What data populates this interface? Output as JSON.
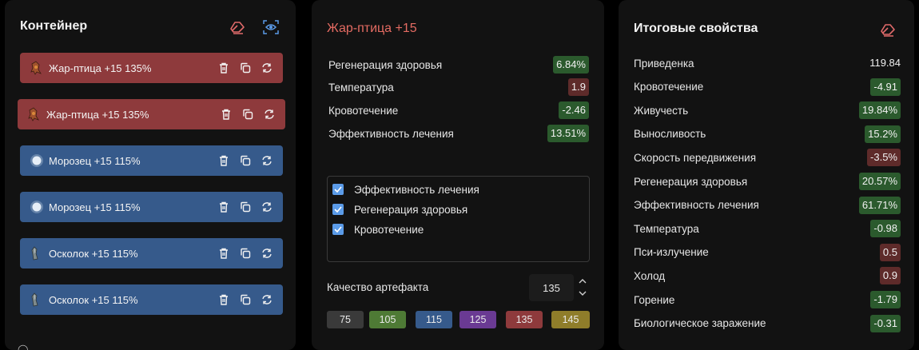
{
  "container": {
    "title": "Контейнер",
    "items": [
      {
        "label": "Жар-птица +15 135%",
        "color": "red",
        "icon": "firebird-artifact-icon"
      },
      {
        "label": "Жар-птица +15 135%",
        "color": "red",
        "icon": "firebird-artifact-icon"
      },
      {
        "label": "Морозец +15 115%",
        "color": "blue",
        "icon": "frost-artifact-icon"
      },
      {
        "label": "Морозец +15 115%",
        "color": "blue",
        "icon": "frost-artifact-icon"
      },
      {
        "label": "Осколок +15 115%",
        "color": "blue",
        "icon": "shard-artifact-icon"
      },
      {
        "label": "Осколок +15 115%",
        "color": "blue",
        "icon": "shard-artifact-icon"
      }
    ]
  },
  "artifact": {
    "title": "Жар-птица +15",
    "stats": [
      {
        "name": "Регенерация здоровья",
        "value": "6.84%",
        "kind": "pos"
      },
      {
        "name": "Температура",
        "value": "1.9",
        "kind": "neg"
      },
      {
        "name": "Кровотечение",
        "value": "-2.46",
        "kind": "pos"
      },
      {
        "name": "Эффективность лечения",
        "value": "13.51%",
        "kind": "pos"
      }
    ],
    "checks": [
      {
        "label": "Эффективность лечения",
        "checked": true
      },
      {
        "label": "Регенерация здоровья",
        "checked": true
      },
      {
        "label": "Кровотечение",
        "checked": true
      }
    ],
    "quality_label": "Качество артефакта",
    "quality_value": "135",
    "quality_buttons": [
      {
        "label": "75",
        "color": "#3a3a3a"
      },
      {
        "label": "105",
        "color": "#4e7a35"
      },
      {
        "label": "115",
        "color": "#365a8b"
      },
      {
        "label": "125",
        "color": "#6a3a93"
      },
      {
        "label": "135",
        "color": "#8e3a3c"
      },
      {
        "label": "145",
        "color": "#8f7d2a"
      }
    ]
  },
  "total": {
    "title": "Итоговые свойства",
    "stats": [
      {
        "name": "Приведенка",
        "value": "119.84",
        "kind": "plain"
      },
      {
        "name": "Кровотечение",
        "value": "-4.91",
        "kind": "pos"
      },
      {
        "name": "Живучесть",
        "value": "19.84%",
        "kind": "pos"
      },
      {
        "name": "Выносливость",
        "value": "15.2%",
        "kind": "pos"
      },
      {
        "name": "Скорость передвижения",
        "value": "-3.5%",
        "kind": "neg"
      },
      {
        "name": "Регенерация здоровья",
        "value": "20.57%",
        "kind": "pos"
      },
      {
        "name": "Эффективность лечения",
        "value": "61.71%",
        "kind": "pos"
      },
      {
        "name": "Температура",
        "value": "-0.98",
        "kind": "pos"
      },
      {
        "name": "Пси-излучение",
        "value": "0.5",
        "kind": "neg"
      },
      {
        "name": "Холод",
        "value": "0.9",
        "kind": "neg"
      },
      {
        "name": "Горение",
        "value": "-1.79",
        "kind": "pos"
      },
      {
        "name": "Биологическое заражение",
        "value": "-0.31",
        "kind": "pos"
      }
    ]
  }
}
